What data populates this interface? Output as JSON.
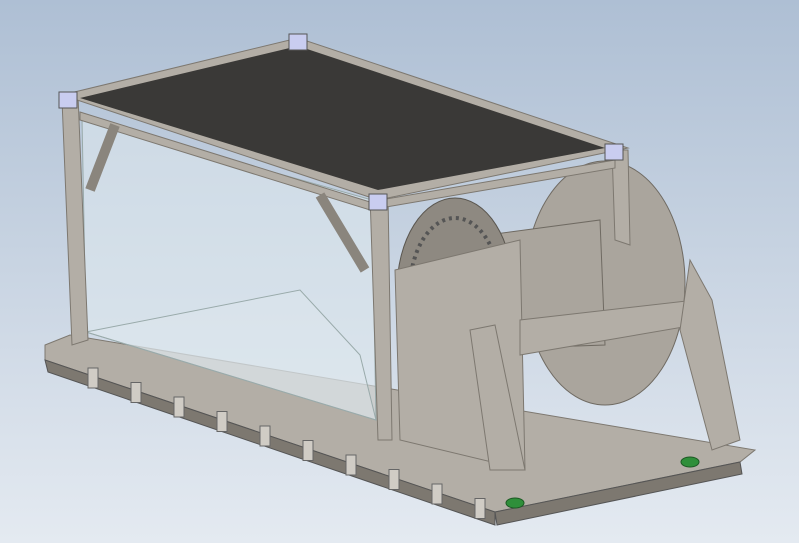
{
  "viewport": {
    "colors": {
      "background_top": "#aebfd4",
      "background_bottom": "#e4eaf1",
      "frame": "#b3aea6",
      "frame_dark": "#7d7870",
      "top_panel": "#3a3937",
      "glass": "#dfe9ef",
      "corner_caster": "#c9cdf0",
      "drum": "#aaa59d",
      "latch": "#2f8f3a"
    }
  }
}
